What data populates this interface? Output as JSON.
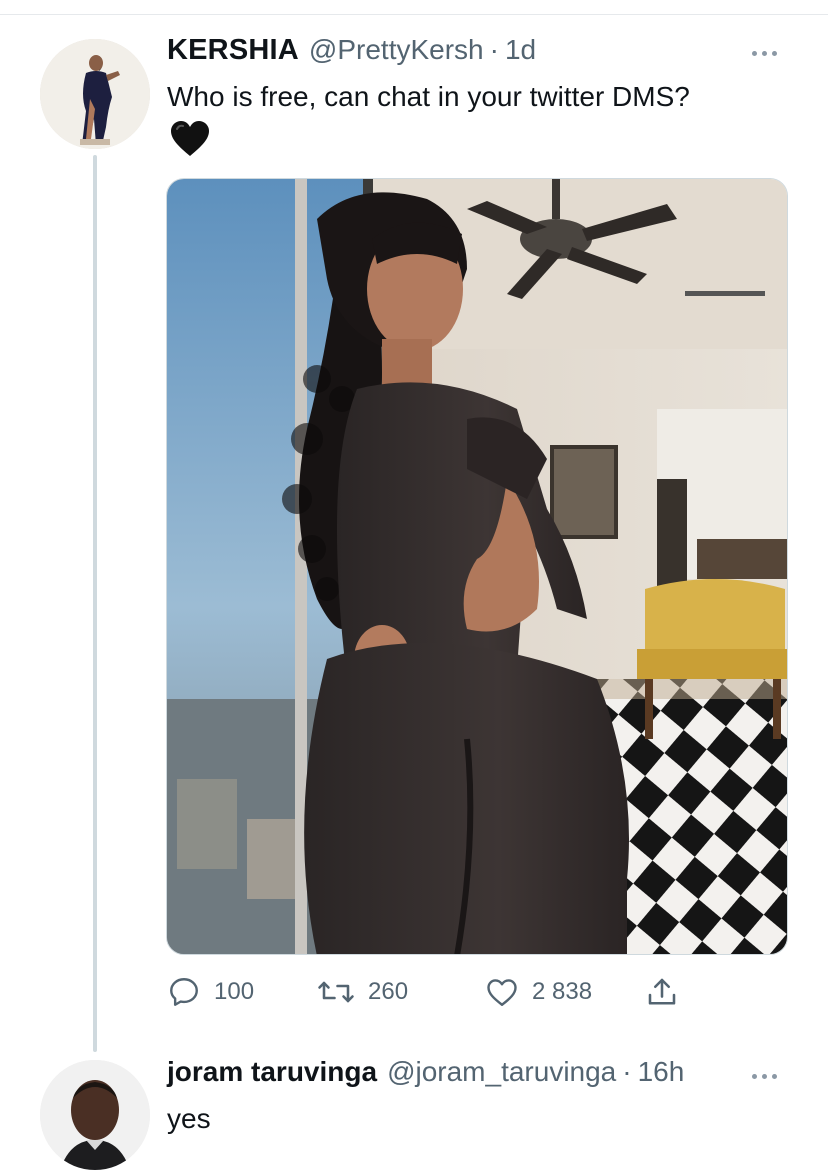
{
  "tweet": {
    "display_name": "KERSHIA",
    "handle": "@PrettyKersh",
    "separator": "·",
    "time": "1d",
    "text": "Who is free, can chat in your twitter DMS?",
    "emoji": "black-heart",
    "media_alt": "",
    "stats": {
      "replies": "100",
      "retweets": "260",
      "likes": "2 838"
    }
  },
  "reply": {
    "display_name": "joram taruvinga",
    "handle": "@joram_taruvinga",
    "separator": "·",
    "time": "16h",
    "text": "yes"
  },
  "icons": {
    "reply": "speech-bubble-icon",
    "retweet": "retweet-icon",
    "like": "heart-outline-icon",
    "share": "share-upload-icon",
    "more": "more-dots-icon"
  },
  "colors": {
    "primary_text": "#0f1419",
    "secondary_text": "#536471",
    "thread_line": "#cfd9de",
    "icon": "#536471"
  }
}
